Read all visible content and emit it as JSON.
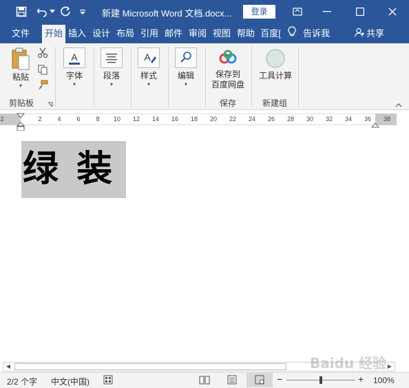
{
  "window": {
    "title": "新建 Microsoft Word 文档.docx...",
    "login_label": "登录"
  },
  "tabs": [
    {
      "label": "文件"
    },
    {
      "label": "开始"
    },
    {
      "label": "插入"
    },
    {
      "label": "设计"
    },
    {
      "label": "布局"
    },
    {
      "label": "引用"
    },
    {
      "label": "邮件"
    },
    {
      "label": "审阅"
    },
    {
      "label": "视图"
    },
    {
      "label": "帮助"
    },
    {
      "label": "百度["
    }
  ],
  "tell_me": {
    "label": "告诉我"
  },
  "share": {
    "label": "共享"
  },
  "ribbon": {
    "paste_label": "粘贴",
    "clipboard_group": "剪贴板",
    "font_label": "字体",
    "paragraph_label": "段落",
    "styles_label": "样式",
    "editing_label": "编辑",
    "save_baidu_line1": "保存到",
    "save_baidu_line2": "百度网盘",
    "save_group": "保存",
    "tool_calc_label": "工具计算",
    "new_group": "新建组"
  },
  "ruler": {
    "ticks": [
      "2",
      "2",
      "4",
      "6",
      "8",
      "10",
      "12",
      "14",
      "16",
      "18",
      "20",
      "22",
      "24",
      "26",
      "28",
      "30",
      "32",
      "34",
      "36",
      "38"
    ]
  },
  "document": {
    "text": "绿 装"
  },
  "statusbar": {
    "pages": "2/2 个字",
    "language": "中文(中国)",
    "zoom": "100%"
  },
  "watermark": "Baidu 经验",
  "colors": {
    "titlebar": "#2b579a",
    "ribbon": "#f3f3f3",
    "highlight": "#c9c9c9"
  }
}
